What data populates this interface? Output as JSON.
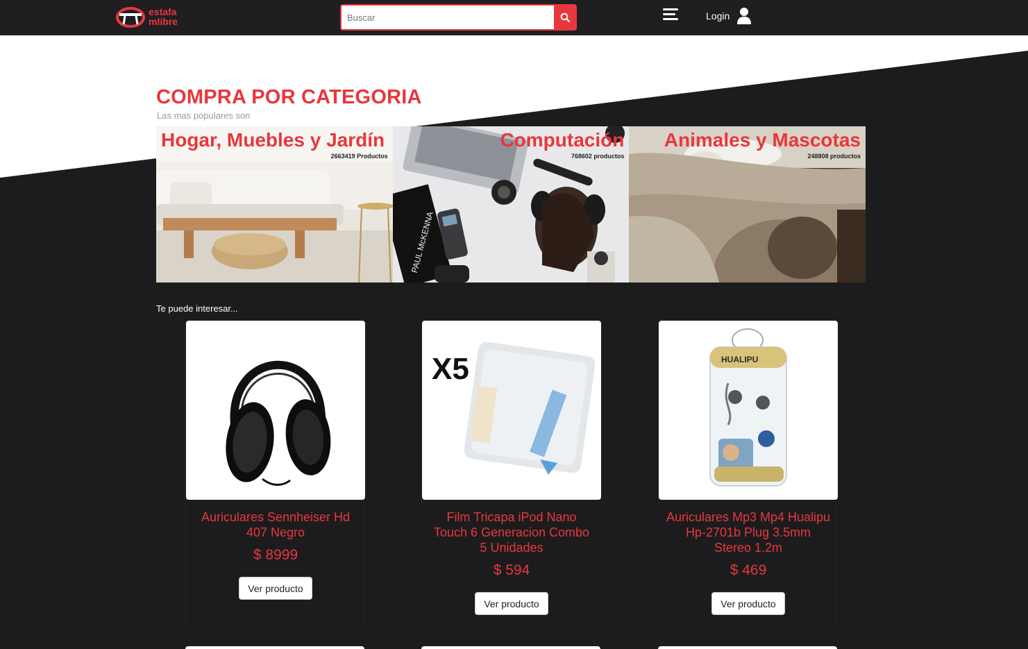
{
  "brand": {
    "line1": "estafa",
    "line2": "mlibre",
    "accent": "#e8373c"
  },
  "search": {
    "placeholder": "Buscar"
  },
  "nav": {
    "login_label": "Login"
  },
  "section": {
    "title": "COMPRA POR CATEGORIA",
    "subtitle": "Las mas populares son"
  },
  "categories": [
    {
      "title": "Hogar, Muebles y Jardín",
      "count": "2663419 Productos"
    },
    {
      "title": "Computación",
      "count": "768602 productos"
    },
    {
      "title": "Animales y Mascotas",
      "count": "248808 productos"
    }
  ],
  "interest_label": "Te puede interesar...",
  "products": [
    {
      "name": "Auriculares Sennheiser Hd 407 Negro",
      "price": "$ 8999",
      "button": "Ver producto"
    },
    {
      "name": "Film Tricapa iPod Nano Touch 6 Generacion Combo 5 Unidades",
      "price": "$ 594",
      "button": "Ver producto",
      "image_text": "X5"
    },
    {
      "name": "Auriculares Mp3 Mp4 Hualipu Hp-2701b Plug 3.5mm Stereo 1.2m",
      "price": "$ 469",
      "button": "Ver producto",
      "image_text": "HUALIPU"
    }
  ]
}
